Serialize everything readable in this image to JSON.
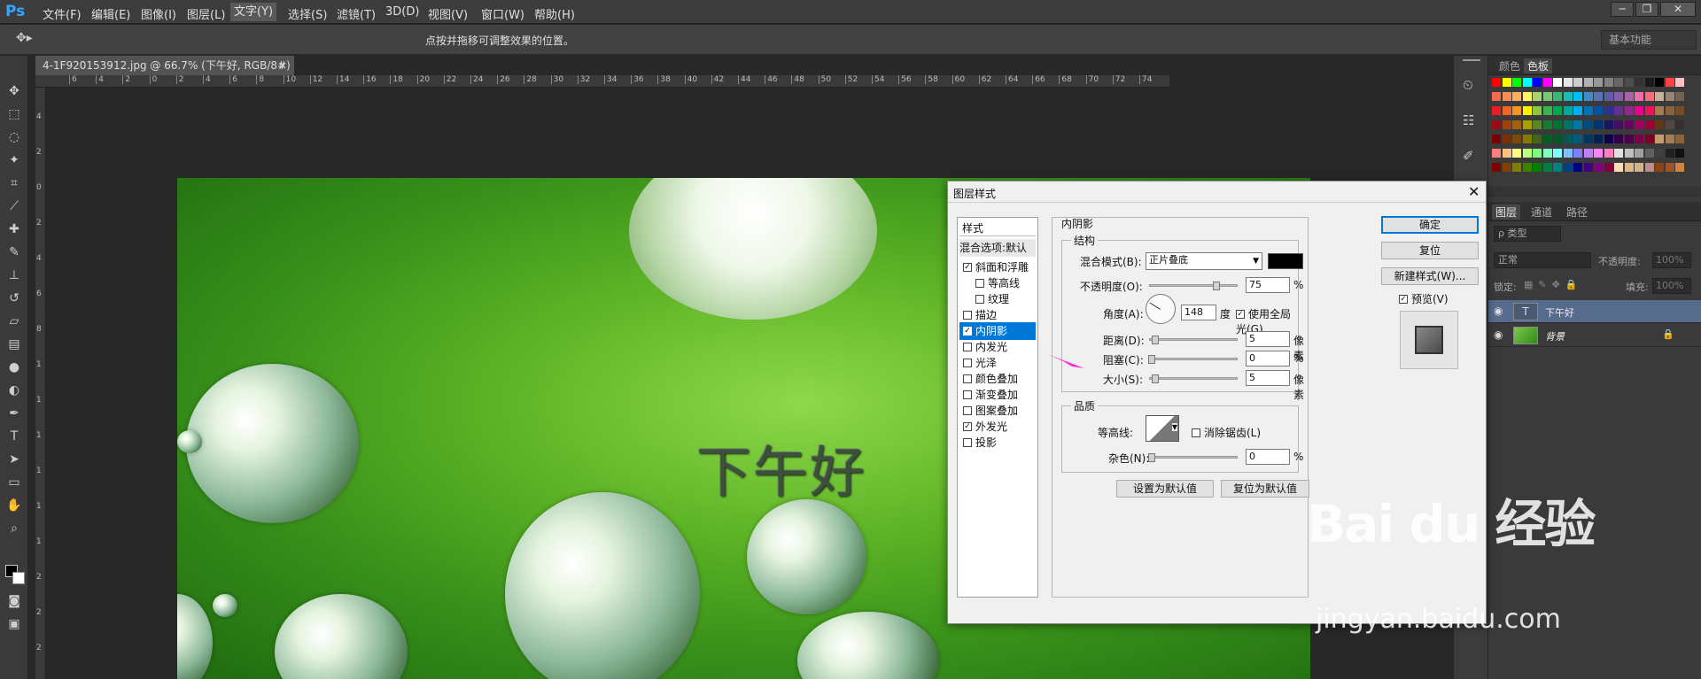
{
  "app": {
    "logo": "Ps"
  },
  "menu": [
    "文件(F)",
    "编辑(E)",
    "图像(I)",
    "图层(L)",
    "文字(Y)",
    "选择(S)",
    "滤镜(T)",
    "3D(D)",
    "视图(V)",
    "窗口(W)",
    "帮助(H)"
  ],
  "menu_active_index": 4,
  "window_buttons": [
    "─",
    "❐",
    "✕"
  ],
  "options": {
    "hint": "点按并拖移可调整效果的位置。",
    "workspace": "基本功能"
  },
  "document": {
    "tab": "4-1F920153912.jpg @ 66.7% (下午好, RGB/8#) *",
    "close": "×",
    "canvas_text": "下午好"
  },
  "ruler_h": [
    "6",
    "4",
    "2",
    "0",
    "2",
    "4",
    "6",
    "8",
    "10",
    "12",
    "14",
    "16",
    "18",
    "20",
    "22",
    "24",
    "26",
    "28",
    "30",
    "32",
    "34",
    "36",
    "38",
    "40",
    "42",
    "44",
    "46",
    "48",
    "50",
    "52",
    "54",
    "56",
    "58",
    "60",
    "62",
    "64",
    "66",
    "68",
    "70",
    "72",
    "74"
  ],
  "ruler_v": [
    "4",
    "2",
    "0",
    "2",
    "4",
    "6",
    "8",
    "1",
    "1",
    "1",
    "1",
    "1",
    "1",
    "2",
    "2",
    "2"
  ],
  "panels": {
    "color_tabs": [
      "颜色",
      "色板"
    ],
    "layers_tabs": [
      "图层",
      "通道",
      "路径"
    ],
    "filter_kind": "ρ 类型",
    "blend_mode": "正常",
    "opacity_label": "不透明度:",
    "opacity_value": "100%",
    "lock_label": "锁定:",
    "fill_label": "填充:",
    "fill_value": "100%",
    "layers": [
      {
        "name": "下午好",
        "thumb": "T",
        "selected": true
      },
      {
        "name": "背景",
        "thumb": "",
        "selected": false
      }
    ]
  },
  "dialog": {
    "title": "图层样式",
    "close": "✕",
    "styles_header": "样式",
    "blend_options": "混合选项:默认",
    "styles": [
      {
        "label": "斜面和浮雕",
        "checked": true,
        "indent": false,
        "selected": false
      },
      {
        "label": "等高线",
        "checked": false,
        "indent": true,
        "selected": false
      },
      {
        "label": "纹理",
        "checked": false,
        "indent": true,
        "selected": false
      },
      {
        "label": "描边",
        "checked": false,
        "indent": false,
        "selected": false
      },
      {
        "label": "内阴影",
        "checked": true,
        "indent": false,
        "selected": true
      },
      {
        "label": "内发光",
        "checked": false,
        "indent": false,
        "selected": false
      },
      {
        "label": "光泽",
        "checked": false,
        "indent": false,
        "selected": false
      },
      {
        "label": "颜色叠加",
        "checked": false,
        "indent": false,
        "selected": false
      },
      {
        "label": "渐变叠加",
        "checked": false,
        "indent": false,
        "selected": false
      },
      {
        "label": "图案叠加",
        "checked": false,
        "indent": false,
        "selected": false
      },
      {
        "label": "外发光",
        "checked": true,
        "indent": false,
        "selected": false
      },
      {
        "label": "投影",
        "checked": false,
        "indent": false,
        "selected": false
      }
    ],
    "section_title": "内阴影",
    "structure": {
      "title": "结构",
      "blend_mode_label": "混合模式(B):",
      "blend_mode_value": "正片叠底",
      "shadow_color": "#000000",
      "opacity_label": "不透明度(O):",
      "opacity_value": "75",
      "opacity_unit": "%",
      "opacity_level": 0.75,
      "angle_label": "角度(A):",
      "angle_value": "148",
      "angle_unit": "度",
      "global_light_label": "使用全局光(G)",
      "global_light_checked": true,
      "distance_label": "距离(D):",
      "distance_value": "5",
      "distance_unit": "像素",
      "choke_label": "阻塞(C):",
      "choke_value": "0",
      "choke_unit": "%",
      "size_label": "大小(S):",
      "size_value": "5",
      "size_unit": "像素"
    },
    "quality": {
      "title": "品质",
      "contour_label": "等高线:",
      "antialias_label": "消除锯齿(L)",
      "antialias_checked": false,
      "noise_label": "杂色(N):",
      "noise_value": "0",
      "noise_unit": "%"
    },
    "make_default": "设置为默认值",
    "reset_default": "复位为默认值",
    "ok": "确定",
    "reset": "复位",
    "new_style": "新建样式(W)...",
    "preview_label": "预览(V)",
    "preview_checked": true
  },
  "watermark": {
    "logo": "Bai du 经验",
    "url": "jingyan.baidu.com"
  },
  "colors": {
    "accent": "#0078d7",
    "arrow": "#ff2fd3",
    "selected_layer": "#576b8d"
  }
}
